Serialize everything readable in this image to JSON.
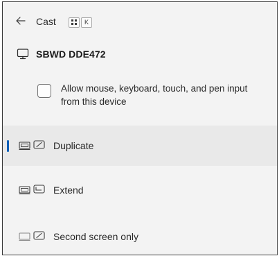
{
  "header": {
    "title": "Cast",
    "shortcut_keys": [
      "⊞",
      "K"
    ]
  },
  "device": {
    "name": "SBWD DDE472"
  },
  "allow_input": {
    "label": "Allow mouse, keyboard, touch, and pen input from this device",
    "checked": false
  },
  "modes": [
    {
      "label": "Duplicate",
      "selected": true,
      "icon": "duplicate-icon"
    },
    {
      "label": "Extend",
      "selected": false,
      "icon": "extend-icon"
    },
    {
      "label": "Second screen only",
      "selected": false,
      "icon": "second-screen-only-icon"
    }
  ],
  "colors": {
    "accent": "#005fb8",
    "panel_bg": "#f3f3f3",
    "selected_bg": "#e9e9e9"
  }
}
